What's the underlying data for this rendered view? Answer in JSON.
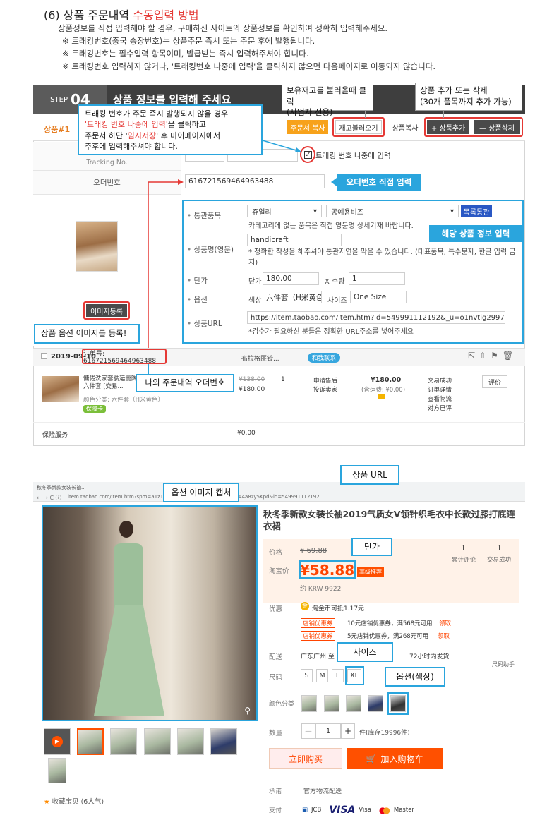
{
  "header": {
    "prefix": "(6) 상품 주문내역 ",
    "title_red": "수동입력 방법",
    "lines": [
      "상품정보를 직접 입력해야 할 경우, 구매하신 사이트의 상품정보를 확인하여 정확히 입력해주세요.",
      "※ 트래킹번호(중국 송장번호)는 상품주문 즉시 또는 주문 후에 발행됩니다.",
      "※ 트래킹번호는 필수입력 항목이며, 발급받는 즉시 입력해주셔야 합니다.",
      "※ 트래킹번호 입력하지 않거나, '트래킹번호 나중에 입력'을 클릭하지 않으면 다음페이지로 이동되지 않습니다."
    ]
  },
  "step": {
    "label": "STEP",
    "number": "04",
    "title": "상품 정보를 입력해 주세요",
    "product_label": "상품#1",
    "buttons": {
      "order_copy": "주문서 복사",
      "load_stock": "재고불러오기",
      "copy_product": "상품복사",
      "add_product": "+ 상품추가",
      "delete_product": "— 상품삭제"
    },
    "tracking_label": "Tracking No.",
    "tracking_later": "트래킹 번호 나중에 입력",
    "order_no_label": "오더번호",
    "order_no_value": "616721569464963488",
    "fields": {
      "customs_label": "통관품목",
      "customs_value1": "쥬얼리",
      "customs_value2": "공예용비즈",
      "customs_button": "목록통관",
      "customs_note": "카테고리에 없는 품목은 직접 영문명 상세기재 바랍니다.",
      "name_label": "상품명(영문)",
      "name_value": "handicraft",
      "name_note": "* 정확한 작성을 해주셔야 통관지연을 막을 수 있습니다. (대표품목, 특수문자, 한글 입력 금지)",
      "price_label": "단가",
      "price_prefix": "단가",
      "price_value": "180.00",
      "qty_prefix": "X 수량",
      "qty_value": "1",
      "option_label": "옵션",
      "color_prefix": "색상",
      "color_value": "六件套（H米黄色）",
      "size_prefix": "사이즈",
      "size_value": "One Size",
      "url_label": "상품URL",
      "url_value": "https://item.taobao.com/item.htm?id=549991112192&_u=o1nvtig29973",
      "url_note": "*검수가 필요하신 분들은 정확한 URL주소를 넣어주세요"
    },
    "image_button": "이미지등록"
  },
  "annotations": {
    "stock_tip": "보유재고를 불러올때 클릭\n(사업자 전용)",
    "add_tip": "상품 추가 또는 삭제\n(30개 품목까지 추가 가능)",
    "tracking_tip_1": "트래킹 번호가 주문 즉시 발행되지 않을 경우",
    "tracking_tip_2a": "'트래킹 번호 나중에 입력'",
    "tracking_tip_2b": "을 클릭하고",
    "tracking_tip_3a": "주문서 하단 '",
    "tracking_tip_3b": "임시저장",
    "tracking_tip_3c": "' 후 마이페이지에서",
    "tracking_tip_4": "추후에 입력해주셔야 합니다.",
    "order_direct": "오더번호 직접 입력",
    "product_info": "해당 상품 정보 입력",
    "image_tip": "상품 옵션 이미지를 등록!",
    "my_order_no": "나의 주문내역 오더번호",
    "option_capture": "옵션 이미지 캡처",
    "product_url": "상품 URL",
    "price_tip": "단가",
    "size_tip": "사이즈",
    "color_tip": "옵션(색상)"
  },
  "order_record": {
    "date": "2019-09-10",
    "order_no": "订单号: 616721569464963488",
    "seller": "布拉格匪铃...",
    "contact": "和我联系",
    "item_title": "慵倦洗家套装运羹陶五件套六件套 [交易...",
    "item_color": "颜色分类: 六件套（H米黄色）",
    "item_badge": "保障卡",
    "old_price": "¥138.00",
    "unit_price": "¥180.00",
    "qty": "1",
    "service": [
      "申请售后",
      "投诉卖家"
    ],
    "total": "¥180.00",
    "shipping": "(含运费: ¥0.00)",
    "status": [
      "交易成功",
      "订单详情",
      "查看物流",
      "对方已评"
    ],
    "review_button": "评价",
    "insurance_label": "保险服务",
    "insurance_value": "¥0.00"
  },
  "taobao": {
    "tab_title": "秋冬季新款女装长袖...",
    "url": "item.taobao.com/item.htm?spm=a1z10.1-c.w4004-21411014.3.1c2c44a8zy5Kpd&id=549991112192",
    "title": "秋冬季新款女装长袖2019气质女V领针织毛衣中长款过膝打底连衣裙",
    "price_label": "价格",
    "old_price": "¥ 69.88",
    "promo_label": "淘宝价",
    "promo_price": "¥58.88",
    "promo_tag": "高级推荐",
    "krw": "约 KRW 9922",
    "reviews_count": "1",
    "reviews_label": "累计评论",
    "sold_count": "1",
    "sold_label": "交易成功",
    "discount_label": "优惠",
    "coin": "淘金币可抵1.17元",
    "coupon_tag": "店铺优惠券",
    "coupon1": "10元店铺优惠券，满568元可用",
    "coupon2": "5元店铺优惠券，满268元可用",
    "coupon_get": "领取",
    "ship_label": "配送",
    "ship_value": "广东广州 至",
    "ship_time": "72小时内发货",
    "size_label": "尺码",
    "size_help": "尺码助手",
    "sizes": [
      "S",
      "M",
      "L",
      "XL"
    ],
    "color_label": "颜色分类",
    "qty_label": "数量",
    "qty_value": "1",
    "stock": "件(库存19996件)",
    "buy_now": "立即购买",
    "add_cart": "加入购物车",
    "promise_label": "承诺",
    "promise_value": "官方物流配送",
    "pay_label": "支付",
    "pay_methods": [
      "JCB",
      "VISA",
      "Visa",
      "Master"
    ],
    "favorite": "收藏宝贝 (6人气)"
  },
  "colors": {
    "accent_red": "#e53935",
    "accent_blue": "#2aa5dd",
    "taobao_orange": "#ff5000",
    "step_orange": "#f7a21b"
  }
}
